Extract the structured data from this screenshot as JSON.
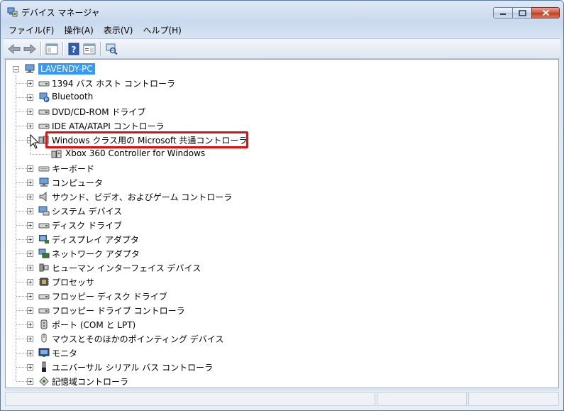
{
  "window": {
    "title": "デバイス マネージャ"
  },
  "menu": [
    {
      "label": "ファイル(F)"
    },
    {
      "label": "操作(A)"
    },
    {
      "label": "表示(V)"
    },
    {
      "label": "ヘルプ(H)"
    }
  ],
  "tree": {
    "root": "LAVENDY-PC",
    "items": [
      {
        "label": "1394 バス ホスト コントローラ",
        "icon": "1394-controller-icon",
        "expanded": false
      },
      {
        "label": "Bluetooth",
        "icon": "bluetooth-icon",
        "expanded": false
      },
      {
        "label": "DVD/CD-ROM ドライブ",
        "icon": "dvd-drive-icon",
        "expanded": false
      },
      {
        "label": "IDE ATA/ATAPI コントローラ",
        "icon": "ide-controller-icon",
        "expanded": false
      },
      {
        "label": "Windows クラス用の Microsoft 共通コントローラ",
        "icon": "game-controller-icon",
        "expanded": true,
        "highlighted": true,
        "children": [
          {
            "label": "Xbox 360 Controller for Windows",
            "icon": "game-controller-icon"
          }
        ]
      },
      {
        "label": "キーボード",
        "icon": "keyboard-icon",
        "expanded": false
      },
      {
        "label": "コンピュータ",
        "icon": "computer-icon",
        "expanded": false
      },
      {
        "label": "サウンド、ビデオ、およびゲーム コントローラ",
        "icon": "speaker-icon",
        "expanded": false
      },
      {
        "label": "システム デバイス",
        "icon": "system-device-icon",
        "expanded": false
      },
      {
        "label": "ディスク ドライブ",
        "icon": "disk-drive-icon",
        "expanded": false
      },
      {
        "label": "ディスプレイ アダプタ",
        "icon": "display-adapter-icon",
        "expanded": false
      },
      {
        "label": "ネットワーク アダプタ",
        "icon": "network-adapter-icon",
        "expanded": false
      },
      {
        "label": "ヒューマン インターフェイス デバイス",
        "icon": "hid-icon",
        "expanded": false
      },
      {
        "label": "プロセッサ",
        "icon": "processor-icon",
        "expanded": false
      },
      {
        "label": "フロッピー ディスク ドライブ",
        "icon": "floppy-drive-icon",
        "expanded": false
      },
      {
        "label": "フロッピー ドライブ コントローラ",
        "icon": "floppy-controller-icon",
        "expanded": false
      },
      {
        "label": "ポート (COM と LPT)",
        "icon": "port-icon",
        "expanded": false
      },
      {
        "label": "マウスとそのほかのポインティング デバイス",
        "icon": "mouse-icon",
        "expanded": false
      },
      {
        "label": "モニタ",
        "icon": "monitor-icon",
        "expanded": false
      },
      {
        "label": "ユニバーサル シリアル バス コントローラ",
        "icon": "usb-icon",
        "expanded": false
      },
      {
        "label": "記憶域コントローラ",
        "icon": "storage-controller-icon",
        "expanded": false
      }
    ]
  },
  "colors": {
    "selection": "#3399ff",
    "highlight_box": "#e01010"
  }
}
